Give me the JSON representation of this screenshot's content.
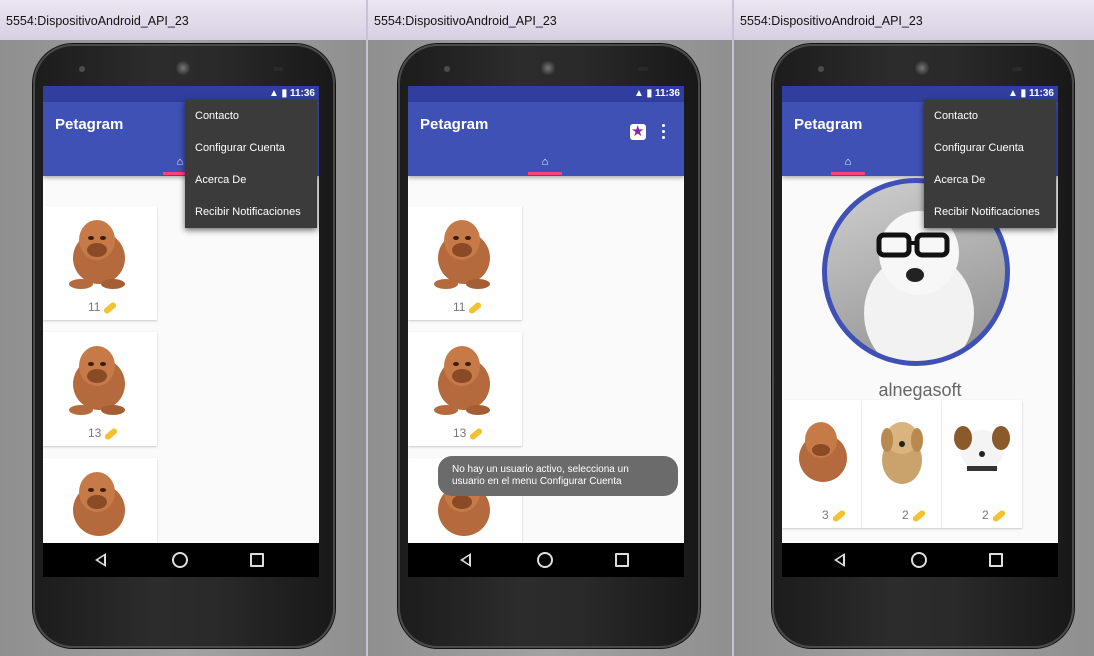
{
  "windows": [
    {
      "title": "5554:DispositivoAndroid_API_23",
      "status_time": "11:36",
      "app_title": "Petagram",
      "menu": [
        "Contacto",
        "Configurar Cuenta",
        "Acerca De",
        "Recibir Notificaciones"
      ],
      "likes": [
        "11",
        "13"
      ]
    },
    {
      "title": "5554:DispositivoAndroid_API_23",
      "status_time": "11:36",
      "app_title": "Petagram",
      "likes": [
        "11",
        "13"
      ],
      "toast": "No hay un usuario activo, selecciona un usuario en el menu Configurar Cuenta"
    },
    {
      "title": "5554:DispositivoAndroid_API_23",
      "status_time": "11:36",
      "app_title": "Petagram",
      "menu": [
        "Contacto",
        "Configurar Cuenta",
        "Acerca De",
        "Recibir Notificaciones"
      ],
      "profile_name": "alnegasoft",
      "thumbs": [
        "3",
        "2",
        "2"
      ]
    }
  ],
  "icons": {
    "home": "home-icon",
    "star": "star-icon",
    "overflow": "overflow-menu-icon",
    "bone": "bone-icon",
    "back": "back-icon",
    "nav_home": "home-circle-icon",
    "recent": "recent-apps-icon"
  },
  "colors": {
    "primary": "#3f51b5",
    "primary_dark": "#303f9f",
    "accent": "#ff4081",
    "menu_bg": "#3b3b3b"
  }
}
